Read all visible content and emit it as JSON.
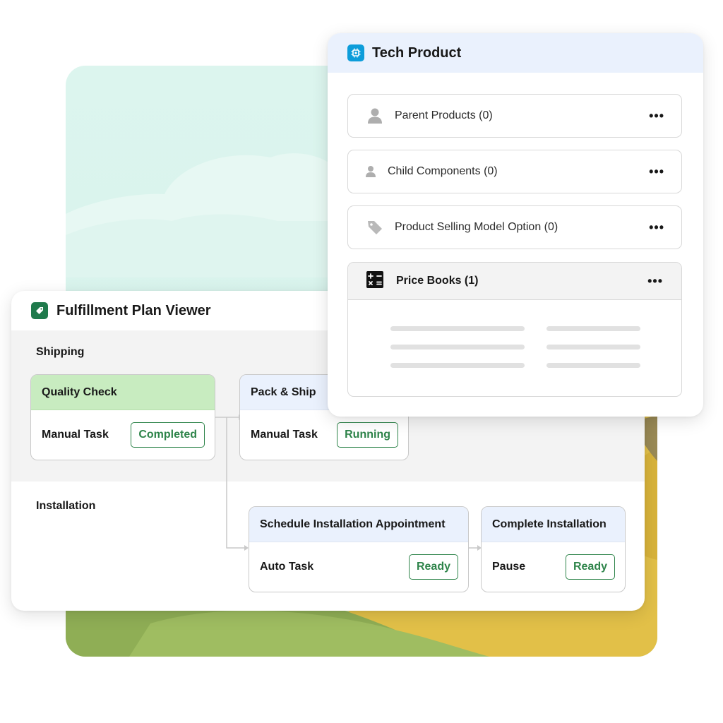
{
  "fulfillment_viewer": {
    "title": "Fulfillment Plan Viewer",
    "icon": "tag-icon",
    "accent": "#1f7a4c",
    "sections": {
      "shipping": "Shipping",
      "installation": "Installation"
    },
    "tasks": [
      {
        "name": "Quality Check",
        "type": "Manual Task",
        "status": "Completed",
        "header_color": "#c8ecc0"
      },
      {
        "name": "Pack & Ship",
        "type": "Manual Task",
        "status": "Running",
        "header_color": "#eaf1fd"
      },
      {
        "name": "Schedule Installation Appointment",
        "type": "Auto Task",
        "status": "Ready",
        "header_color": "#eaf1fd"
      },
      {
        "name": "Complete Installation",
        "type": "Pause",
        "status": "Ready",
        "header_color": "#eaf1fd"
      }
    ],
    "status_color": "#2e844a"
  },
  "tech_product": {
    "title": "Tech Product",
    "icon": "chip-icon",
    "accent": "#0d9dda",
    "related_lists": [
      {
        "label": "Parent Products (0)",
        "icon": "person-icon"
      },
      {
        "label": "Child Components (0)",
        "icon": "person-small-icon"
      },
      {
        "label": "Product Selling Model Option (0)",
        "icon": "price-tag-icon"
      }
    ],
    "price_books": {
      "label": "Price Books (1)",
      "icon": "calculator-icon"
    }
  }
}
